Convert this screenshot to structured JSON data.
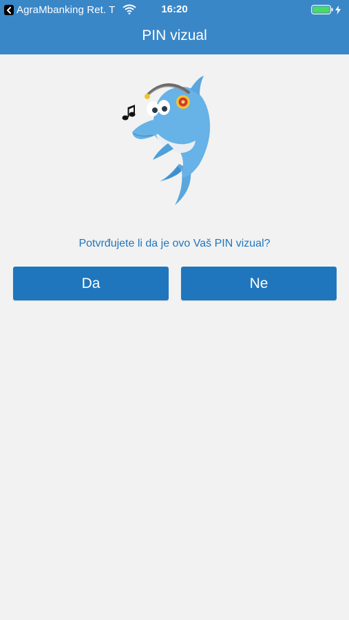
{
  "status_bar": {
    "back_app_label": "AgraMbanking Ret. T",
    "time": "16:20"
  },
  "header": {
    "title": "PIN vizual"
  },
  "main": {
    "question": "Potvrđujete li da je ovo Vaš PIN vizual?",
    "buttons": {
      "yes_label": "Da",
      "no_label": "Ne"
    }
  },
  "colors": {
    "header_bg": "#3a87c8",
    "button_bg": "#1f76bd",
    "question_text": "#1f76bd",
    "page_bg": "#f2f2f2",
    "battery": "#4cd964"
  },
  "icons": {
    "back": "chevron-left-icon",
    "wifi": "wifi-icon",
    "battery": "battery-icon",
    "charging": "bolt-icon",
    "mascot": "dolphin-with-headphones-image",
    "note": "music-note-icon"
  }
}
